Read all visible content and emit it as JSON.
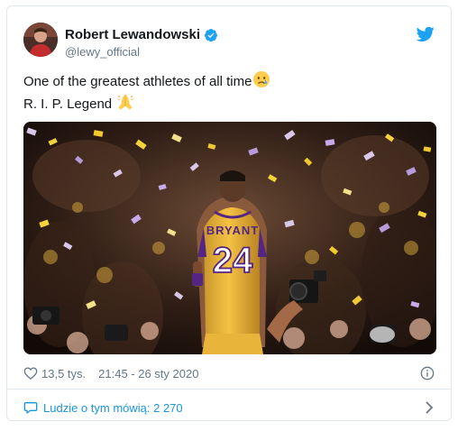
{
  "tweet": {
    "author_name": "Robert Lewandowski",
    "author_handle": "@lewy_official",
    "text_line1": "One of the greatest athletes of all time",
    "text_line2": "R. I. P. Legend",
    "emoji1": "crying-face-emoji",
    "emoji2": "folded-hands-emoji",
    "media": {
      "jersey_name": "BRYANT",
      "jersey_number": "24"
    },
    "likes": "13,5 tys.",
    "timestamp": "21:45 - 26 sty 2020",
    "talk_label": "Ludzie o tym mówią: 2 270"
  },
  "colors": {
    "twitter_blue": "#1da1f2",
    "link_blue": "#1b95e0",
    "secondary_text": "#657786",
    "jersey_gold": "#f5c243",
    "jersey_purple": "#552583"
  },
  "icons": [
    "verified-badge-icon",
    "twitter-bird-icon",
    "heart-icon",
    "info-icon",
    "speech-bubble-icon",
    "chevron-right-icon"
  ]
}
